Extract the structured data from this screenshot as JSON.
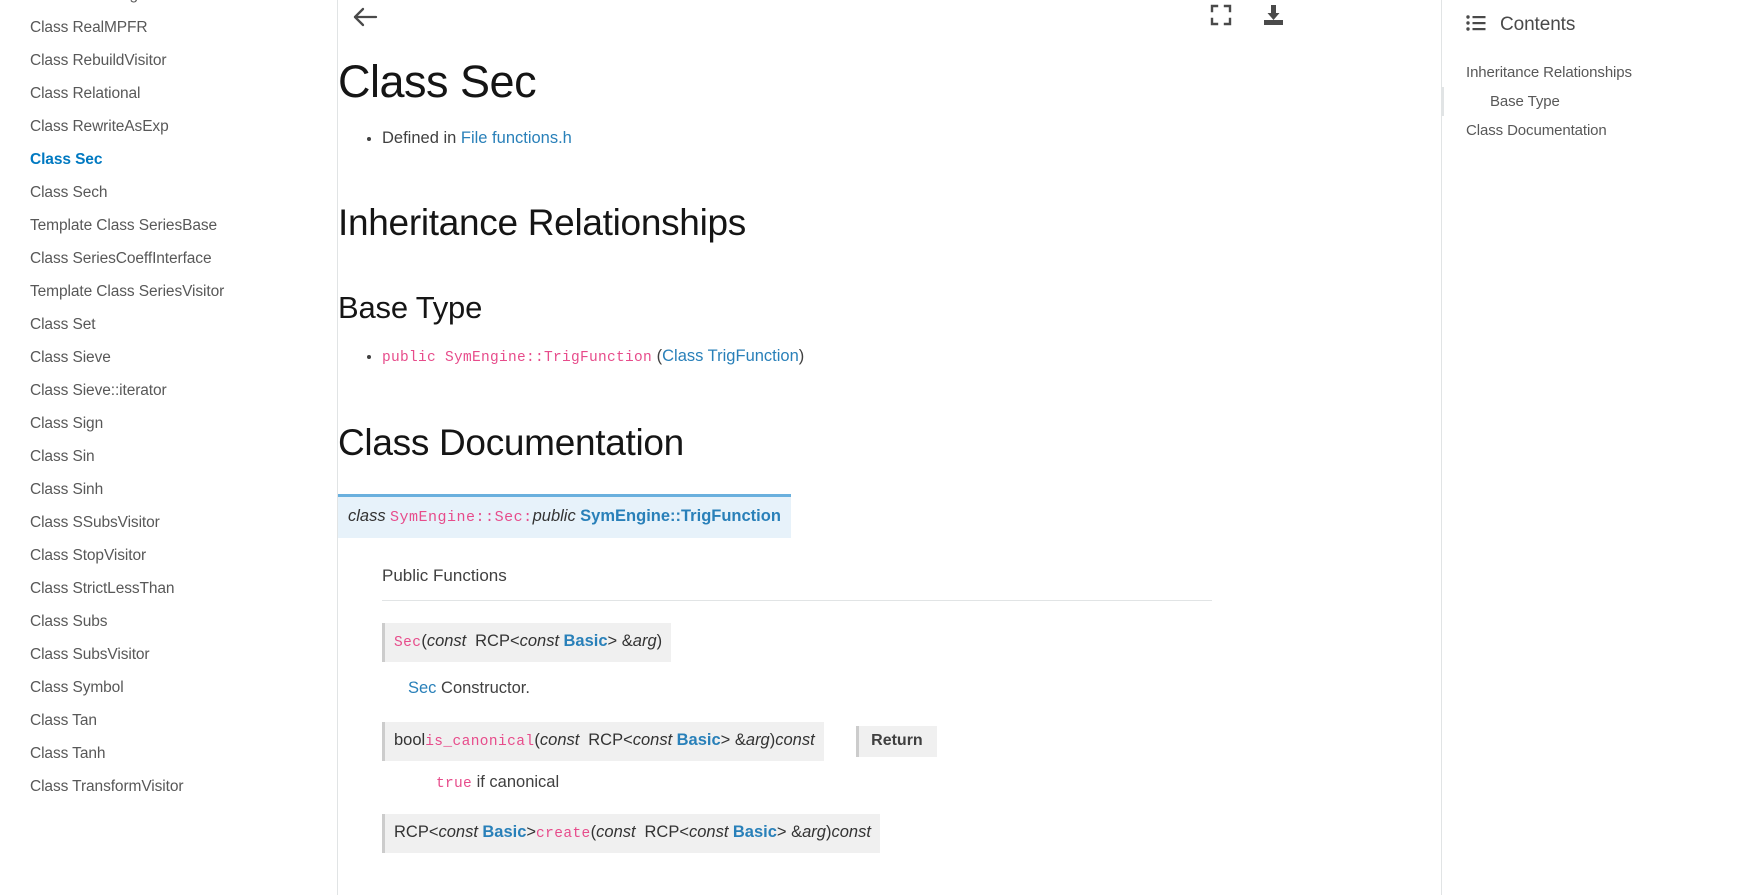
{
  "sidebar": {
    "items": [
      {
        "label": "Class RealImagVisitor",
        "current": false
      },
      {
        "label": "Class RealMPFR",
        "current": false
      },
      {
        "label": "Class RebuildVisitor",
        "current": false
      },
      {
        "label": "Class Relational",
        "current": false
      },
      {
        "label": "Class RewriteAsExp",
        "current": false
      },
      {
        "label": "Class Sec",
        "current": true
      },
      {
        "label": "Class Sech",
        "current": false
      },
      {
        "label": "Template Class SeriesBase",
        "current": false
      },
      {
        "label": "Class SeriesCoeffInterface",
        "current": false
      },
      {
        "label": "Template Class SeriesVisitor",
        "current": false
      },
      {
        "label": "Class Set",
        "current": false
      },
      {
        "label": "Class Sieve",
        "current": false
      },
      {
        "label": "Class Sieve::iterator",
        "current": false
      },
      {
        "label": "Class Sign",
        "current": false
      },
      {
        "label": "Class Sin",
        "current": false
      },
      {
        "label": "Class Sinh",
        "current": false
      },
      {
        "label": "Class SSubsVisitor",
        "current": false
      },
      {
        "label": "Class StopVisitor",
        "current": false
      },
      {
        "label": "Class StrictLessThan",
        "current": false
      },
      {
        "label": "Class Subs",
        "current": false
      },
      {
        "label": "Class SubsVisitor",
        "current": false
      },
      {
        "label": "Class Symbol",
        "current": false
      },
      {
        "label": "Class Tan",
        "current": false
      },
      {
        "label": "Class Tanh",
        "current": false
      },
      {
        "label": "Class TransformVisitor",
        "current": false
      }
    ]
  },
  "toolbar": {
    "back_icon": "arrow-left-icon",
    "fullscreen_icon": "fullscreen-icon",
    "download_icon": "download-icon"
  },
  "main": {
    "title": "Class Sec",
    "defined_in_prefix": "Defined in ",
    "defined_in_link": "File functions.h",
    "inheritance_heading": "Inheritance Relationships",
    "base_type_heading": "Base Type",
    "base_type": {
      "code": "public SymEngine::TrigFunction",
      "paren_open": "(",
      "link": "Class TrigFunction",
      "paren_close": ")"
    },
    "class_doc_heading": "Class Documentation",
    "declaration": {
      "keyword": "class",
      "name": "SymEngine::Sec",
      "colon": ":",
      "access": "public",
      "base": "SymEngine::TrigFunction"
    },
    "public_functions_label": "Public Functions",
    "functions": [
      {
        "name": "Sec",
        "return_type": "",
        "params_pre": "(",
        "p_const1": "const",
        "p_rcp": "RCP<",
        "p_const2": "const",
        "p_basic": "Basic",
        "p_gt": "> &",
        "p_arg": "arg",
        "params_post": ")",
        "suffix": "",
        "description_link": "Sec",
        "description_text": " Constructor."
      },
      {
        "name": "is_canonical",
        "return_type": "bool",
        "params_pre": "(",
        "p_const1": "const",
        "p_rcp": "RCP<",
        "p_const2": "const",
        "p_basic": "Basic",
        "p_gt": "> &",
        "p_arg": "arg",
        "params_post": ")",
        "suffix": "const",
        "return_label": "Return",
        "return_code": "true",
        "return_text": " if canonical"
      },
      {
        "name": "create",
        "return_type_rcp": "RCP<",
        "return_type_const": "const",
        "return_type_basic": "Basic",
        "return_type_gt": ">",
        "params_pre": "(",
        "p_const1": "const",
        "p_rcp": "RCP<",
        "p_const2": "const",
        "p_basic": "Basic",
        "p_gt": "> &",
        "p_arg": "arg",
        "params_post": ")",
        "suffix": "const"
      }
    ]
  },
  "contents": {
    "icon": "list-icon",
    "title": "Contents",
    "items": [
      {
        "label": "Inheritance Relationships",
        "sub": false
      },
      {
        "label": "Base Type",
        "sub": true
      },
      {
        "label": "Class Documentation",
        "sub": false
      }
    ]
  },
  "colors": {
    "accent_link": "#2980b9",
    "code_pink": "#e74c8b",
    "decl_bg": "#e7f2fa",
    "decl_border": "#6ab0de",
    "sig_bg": "#f0f0f0",
    "current_nav": "#0079c1"
  }
}
